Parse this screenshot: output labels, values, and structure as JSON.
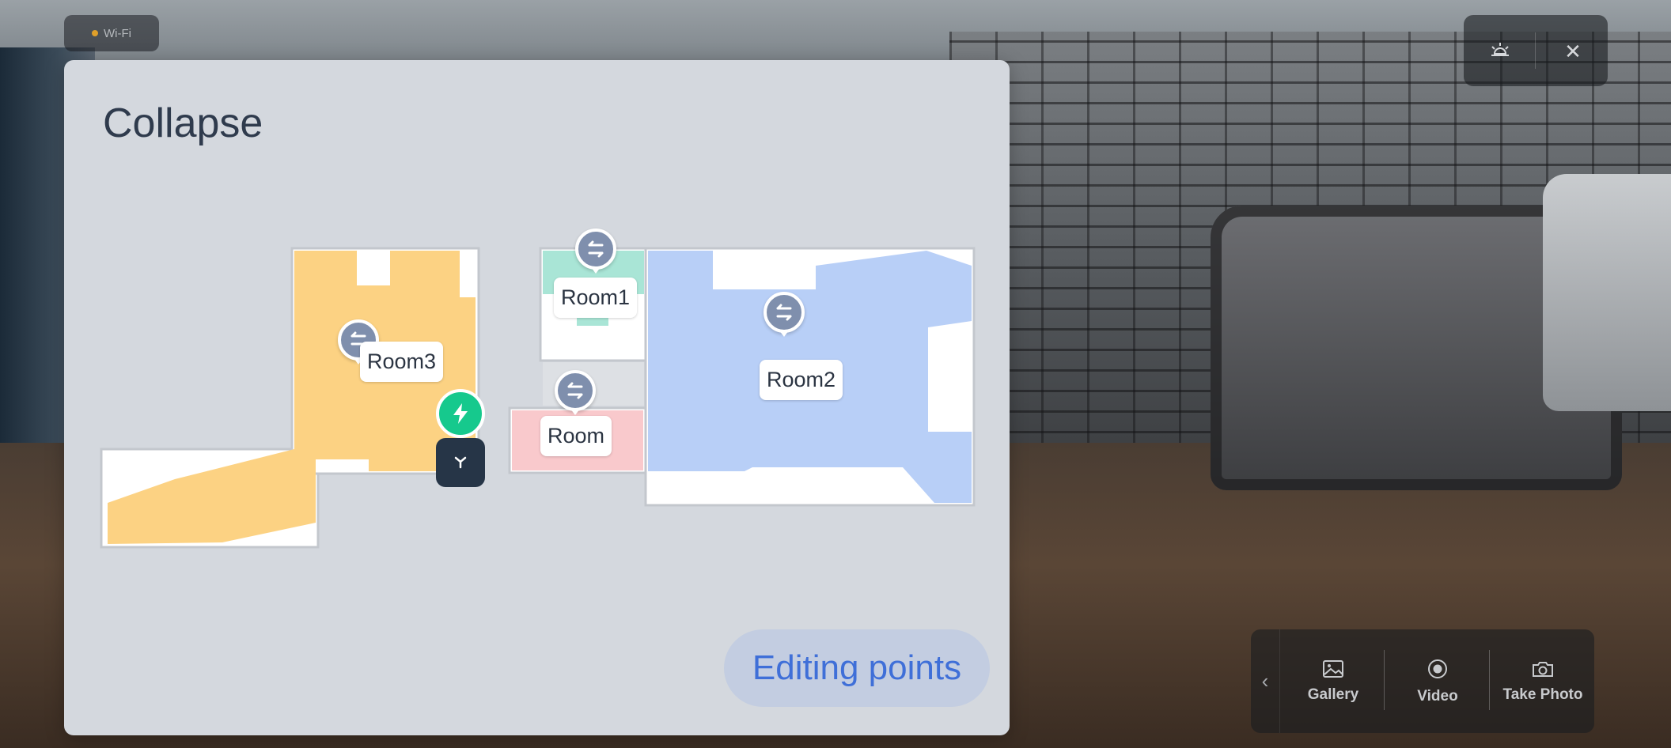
{
  "wifi": {
    "label": "Wi-Fi",
    "status_color": "#e0a02a"
  },
  "top_controls": {
    "icons": [
      "brightness-icon",
      "close-icon"
    ],
    "close_glyph": "✕"
  },
  "map_panel": {
    "title": "Collapse",
    "rooms": [
      {
        "name": "Room1",
        "color": "#a9e5d6"
      },
      {
        "name": "Room2",
        "color": "#b8cff7"
      },
      {
        "name": "Room3",
        "color": "#fcd283"
      },
      {
        "name": "Room",
        "color": "#f9c9cc"
      }
    ],
    "markers": {
      "pin_icon": "swap-route-icon",
      "dock_icon": "lightning-icon",
      "robot_icon": "robot-icon"
    },
    "edit_button": "Editing points"
  },
  "toolbar": {
    "collapse_glyph": "‹",
    "items": [
      {
        "label": "Gallery",
        "icon": "image-icon"
      },
      {
        "label": "Video",
        "icon": "record-icon"
      },
      {
        "label": "Take Photo",
        "icon": "camera-icon"
      }
    ]
  }
}
